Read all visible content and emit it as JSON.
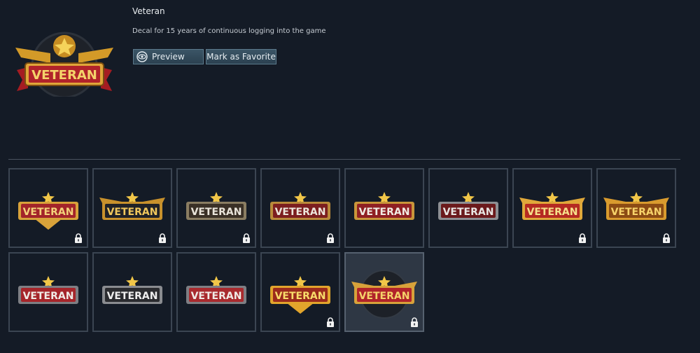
{
  "detail": {
    "title": "Veteran",
    "description": "Decal for 15 years of continuous logging into the game",
    "preview_label": "Preview",
    "favorite_label": "Mark as Favorite",
    "hero_text": "VETERAN"
  },
  "grid": {
    "items": [
      {
        "text": "VETERAN",
        "style": "gold-shield-red",
        "locked": true
      },
      {
        "text": "VETERAN",
        "style": "dark-wings",
        "locked": true
      },
      {
        "text": "VETERAN",
        "style": "silver-plate",
        "locked": true
      },
      {
        "text": "VETERAN",
        "style": "red-ribbon-small",
        "locked": true
      },
      {
        "text": "VETERAN",
        "style": "red-ribbon",
        "locked": false
      },
      {
        "text": "VETERAN",
        "style": "grey-red-star",
        "locked": false
      },
      {
        "text": "VETERAN",
        "style": "gold-wings-red",
        "locked": true
      },
      {
        "text": "VETERAN",
        "style": "gold-wings",
        "locked": true
      },
      {
        "text": "VETERAN",
        "style": "red-bar",
        "locked": false
      },
      {
        "text": "VETERAN",
        "style": "grey-bar",
        "locked": false
      },
      {
        "text": "VETERAN",
        "style": "red-bar-3star",
        "locked": false
      },
      {
        "text": "VETERAN",
        "style": "gold-shield-chevron",
        "locked": true
      },
      {
        "text": "VETERAN",
        "style": "ribbon-wreath",
        "locked": true,
        "selected": true
      }
    ]
  },
  "colors": {
    "background": "#141b26",
    "gold": "#e2a52c",
    "red": "#b3232a",
    "button": "#2f4755"
  }
}
